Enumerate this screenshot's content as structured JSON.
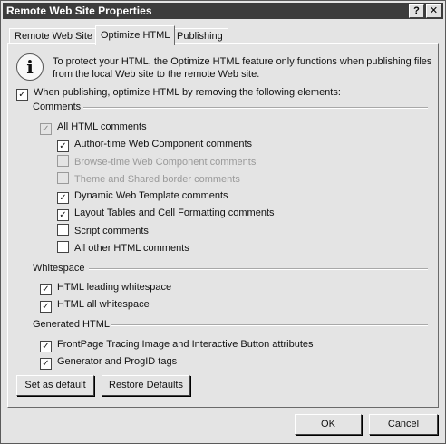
{
  "window": {
    "title": "Remote Web Site Properties",
    "help_label": "?",
    "close_label": "✕"
  },
  "tabs": [
    {
      "label": "Remote Web Site",
      "active": false
    },
    {
      "label": "Optimize HTML",
      "active": true
    },
    {
      "label": "Publishing",
      "active": false
    }
  ],
  "info": {
    "icon": "info-icon",
    "text": "To protect your HTML, the Optimize HTML feature only functions when publishing files from the local Web site to the remote Web site."
  },
  "main_option": {
    "label": "When publishing, optimize HTML by removing the following elements:",
    "checked": true
  },
  "groups": {
    "comments": {
      "title": "Comments",
      "all": {
        "label": "All HTML comments",
        "checked": true,
        "disabled": true
      },
      "items": [
        {
          "label": "Author-time Web Component comments",
          "checked": true,
          "disabled": false
        },
        {
          "label": "Browse-time Web Component comments",
          "checked": false,
          "disabled": true
        },
        {
          "label": "Theme and Shared border comments",
          "checked": false,
          "disabled": true
        },
        {
          "label": "Dynamic Web Template comments",
          "checked": true,
          "disabled": false
        },
        {
          "label": "Layout Tables and Cell Formatting comments",
          "checked": true,
          "disabled": false
        },
        {
          "label": "Script comments",
          "checked": false,
          "disabled": false
        },
        {
          "label": "All other HTML comments",
          "checked": false,
          "disabled": false
        }
      ]
    },
    "whitespace": {
      "title": "Whitespace",
      "items": [
        {
          "label": "HTML leading whitespace",
          "checked": true
        },
        {
          "label": "HTML all whitespace",
          "checked": true
        }
      ]
    },
    "generated": {
      "title": "Generated HTML",
      "items": [
        {
          "label": "FrontPage Tracing Image and Interactive Button attributes",
          "checked": true
        },
        {
          "label": "Generator and ProgID tags",
          "checked": true
        }
      ]
    }
  },
  "buttons": {
    "set_default": "Set as default",
    "restore": "Restore Defaults",
    "ok": "OK",
    "cancel": "Cancel"
  }
}
